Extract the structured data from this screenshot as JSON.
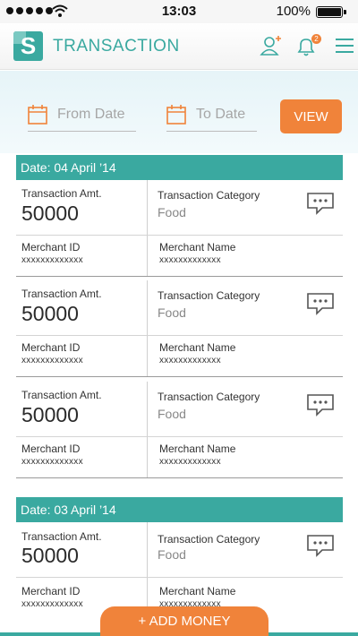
{
  "status_bar": {
    "time": "13:03",
    "battery": "100%"
  },
  "header": {
    "logo_letter": "S",
    "title": "TRANSACTION",
    "notification_count": "2"
  },
  "filters": {
    "from_date_label": "From Date",
    "to_date_label": "To Date",
    "view_label": "VIEW"
  },
  "labels": {
    "amount": "Transaction Amt.",
    "category": "Transaction Category",
    "merchant_id": "Merchant ID",
    "merchant_name": "Merchant Name"
  },
  "groups": [
    {
      "date": "Date: 04 April ’14",
      "transactions": [
        {
          "amount": "50000",
          "category": "Food",
          "merchant_id": "xxxxxxxxxxxxx",
          "merchant_name": "xxxxxxxxxxxxx"
        },
        {
          "amount": "50000",
          "category": "Food",
          "merchant_id": "xxxxxxxxxxxxx",
          "merchant_name": "xxxxxxxxxxxxx"
        },
        {
          "amount": "50000",
          "category": "Food",
          "merchant_id": "xxxxxxxxxxxxx",
          "merchant_name": "xxxxxxxxxxxxx"
        }
      ]
    },
    {
      "date": "Date: 03 April ’14",
      "transactions": [
        {
          "amount": "50000",
          "category": "Food",
          "merchant_id": "xxxxxxxxxxxxx",
          "merchant_name": "xxxxxxxxxxxxx"
        }
      ]
    }
  ],
  "add_money_label": "+ ADD MONEY",
  "colors": {
    "accent": "#3aa9a0",
    "action": "#f0833a"
  }
}
